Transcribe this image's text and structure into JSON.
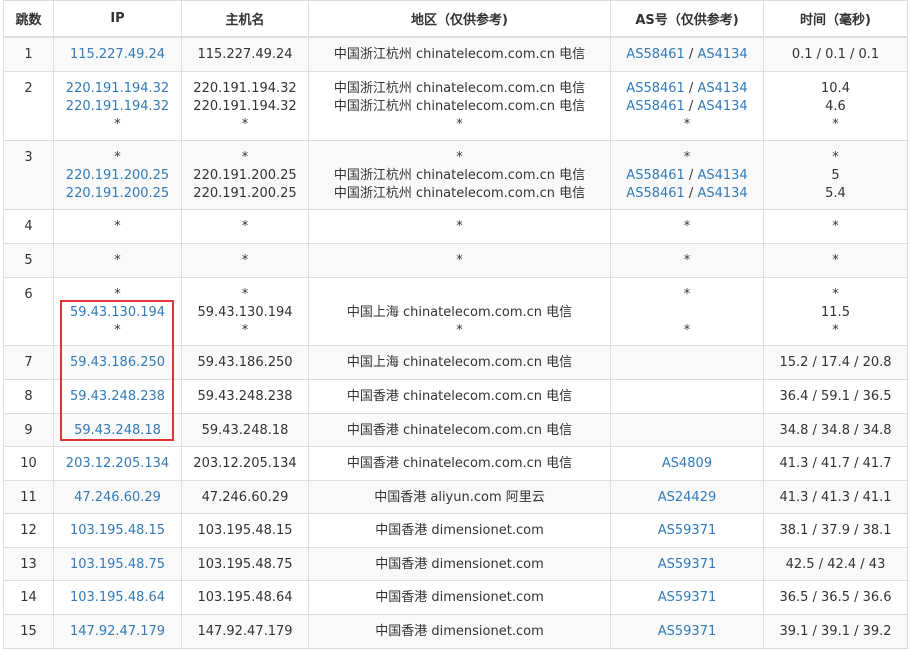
{
  "columns": [
    "跳数",
    "IP",
    "主机名",
    "地区（仅供参考)",
    "AS号（仅供参考)",
    "时间（毫秒)"
  ],
  "rows": [
    {
      "hop": "1",
      "h": 34,
      "lines": [
        {
          "ip": "115.227.49.24",
          "host": "115.227.49.24",
          "region": "中国浙江杭州 chinatelecom.com.cn 电信",
          "as": [
            "AS58461",
            "AS4134"
          ],
          "time": "0.1 / 0.1 / 0.1"
        }
      ]
    },
    {
      "hop": "2",
      "h": 69,
      "lines": [
        {
          "ip": "220.191.194.32",
          "host": "220.191.194.32",
          "region": "中国浙江杭州 chinatelecom.com.cn 电信",
          "as": [
            "AS58461",
            "AS4134"
          ],
          "time": "10.4"
        },
        {
          "ip": "220.191.194.32",
          "host": "220.191.194.32",
          "region": "中国浙江杭州 chinatelecom.com.cn 电信",
          "as": [
            "AS58461",
            "AS4134"
          ],
          "time": "4.6"
        },
        {
          "ip": "*",
          "host": "*",
          "region": "*",
          "as": [
            "*"
          ],
          "time": "*"
        }
      ]
    },
    {
      "hop": "3",
      "h": 69,
      "lines": [
        {
          "ip": "*",
          "host": "*",
          "region": "*",
          "as": [
            "*"
          ],
          "time": "*"
        },
        {
          "ip": "220.191.200.25",
          "host": "220.191.200.25",
          "region": "中国浙江杭州 chinatelecom.com.cn 电信",
          "as": [
            "AS58461",
            "AS4134"
          ],
          "time": "5"
        },
        {
          "ip": "220.191.200.25",
          "host": "220.191.200.25",
          "region": "中国浙江杭州 chinatelecom.com.cn 电信",
          "as": [
            "AS58461",
            "AS4134"
          ],
          "time": "5.4"
        }
      ]
    },
    {
      "hop": "4",
      "h": 34,
      "lines": [
        {
          "ip": "*",
          "host": "*",
          "region": "*",
          "as": [
            "*"
          ],
          "time": "*"
        }
      ]
    },
    {
      "hop": "5",
      "h": 34,
      "lines": [
        {
          "ip": "*",
          "host": "*",
          "region": "*",
          "as": [
            "*"
          ],
          "time": "*"
        }
      ]
    },
    {
      "hop": "6",
      "h": 68,
      "lines": [
        {
          "ip": "*",
          "host": "*",
          "region": "",
          "as": [
            "*"
          ],
          "time": "*"
        },
        {
          "ip": "59.43.130.194",
          "host": "59.43.130.194",
          "region": "中国上海 chinatelecom.com.cn 电信",
          "as": [],
          "time": "11.5"
        },
        {
          "ip": "*",
          "host": "*",
          "region": "*",
          "as": [
            "*"
          ],
          "time": "*"
        }
      ]
    },
    {
      "hop": "7",
      "h": 34,
      "lines": [
        {
          "ip": "59.43.186.250",
          "host": "59.43.186.250",
          "region": "中国上海 chinatelecom.com.cn 电信",
          "as": [],
          "time": "15.2 / 17.4 / 20.8"
        }
      ]
    },
    {
      "hop": "8",
      "h": 34,
      "lines": [
        {
          "ip": "59.43.248.238",
          "host": "59.43.248.238",
          "region": "中国香港 chinatelecom.com.cn 电信",
          "as": [],
          "time": "36.4 / 59.1 / 36.5"
        }
      ]
    },
    {
      "hop": "9",
      "h": 33,
      "lines": [
        {
          "ip": "59.43.248.18",
          "host": "59.43.248.18",
          "region": "中国香港 chinatelecom.com.cn 电信",
          "as": [],
          "time": "34.8 / 34.8 / 34.8"
        }
      ]
    },
    {
      "hop": "10",
      "h": 34,
      "lines": [
        {
          "ip": "203.12.205.134",
          "host": "203.12.205.134",
          "region": "中国香港 chinatelecom.com.cn 电信",
          "as": [
            "AS4809"
          ],
          "time": "41.3 / 41.7 / 41.7"
        }
      ]
    },
    {
      "hop": "11",
      "h": 33,
      "lines": [
        {
          "ip": "47.246.60.29",
          "host": "47.246.60.29",
          "region": "中国香港 aliyun.com 阿里云",
          "as": [
            "AS24429"
          ],
          "time": "41.3 / 41.3 / 41.1"
        }
      ]
    },
    {
      "hop": "12",
      "h": 34,
      "lines": [
        {
          "ip": "103.195.48.15",
          "host": "103.195.48.15",
          "region": "中国香港 dimensionet.com",
          "as": [
            "AS59371"
          ],
          "time": "38.1 / 37.9 / 38.1"
        }
      ]
    },
    {
      "hop": "13",
      "h": 33,
      "lines": [
        {
          "ip": "103.195.48.75",
          "host": "103.195.48.75",
          "region": "中国香港 dimensionet.com",
          "as": [
            "AS59371"
          ],
          "time": "42.5 / 42.4 / 43"
        }
      ]
    },
    {
      "hop": "14",
      "h": 34,
      "lines": [
        {
          "ip": "103.195.48.64",
          "host": "103.195.48.64",
          "region": "中国香港 dimensionet.com",
          "as": [
            "AS59371"
          ],
          "time": "36.5 / 36.5 / 36.6"
        }
      ]
    },
    {
      "hop": "15",
      "h": 34,
      "lines": [
        {
          "ip": "147.92.47.179",
          "host": "147.92.47.179",
          "region": "中国香港 dimensionet.com",
          "as": [
            "AS59371"
          ],
          "time": "39.1 / 39.1 / 39.2"
        }
      ]
    }
  ],
  "colors": {
    "link": "#337ab7",
    "highlight": "#e03535",
    "border": "#dddddd",
    "stripe": "#f9f9f9"
  }
}
